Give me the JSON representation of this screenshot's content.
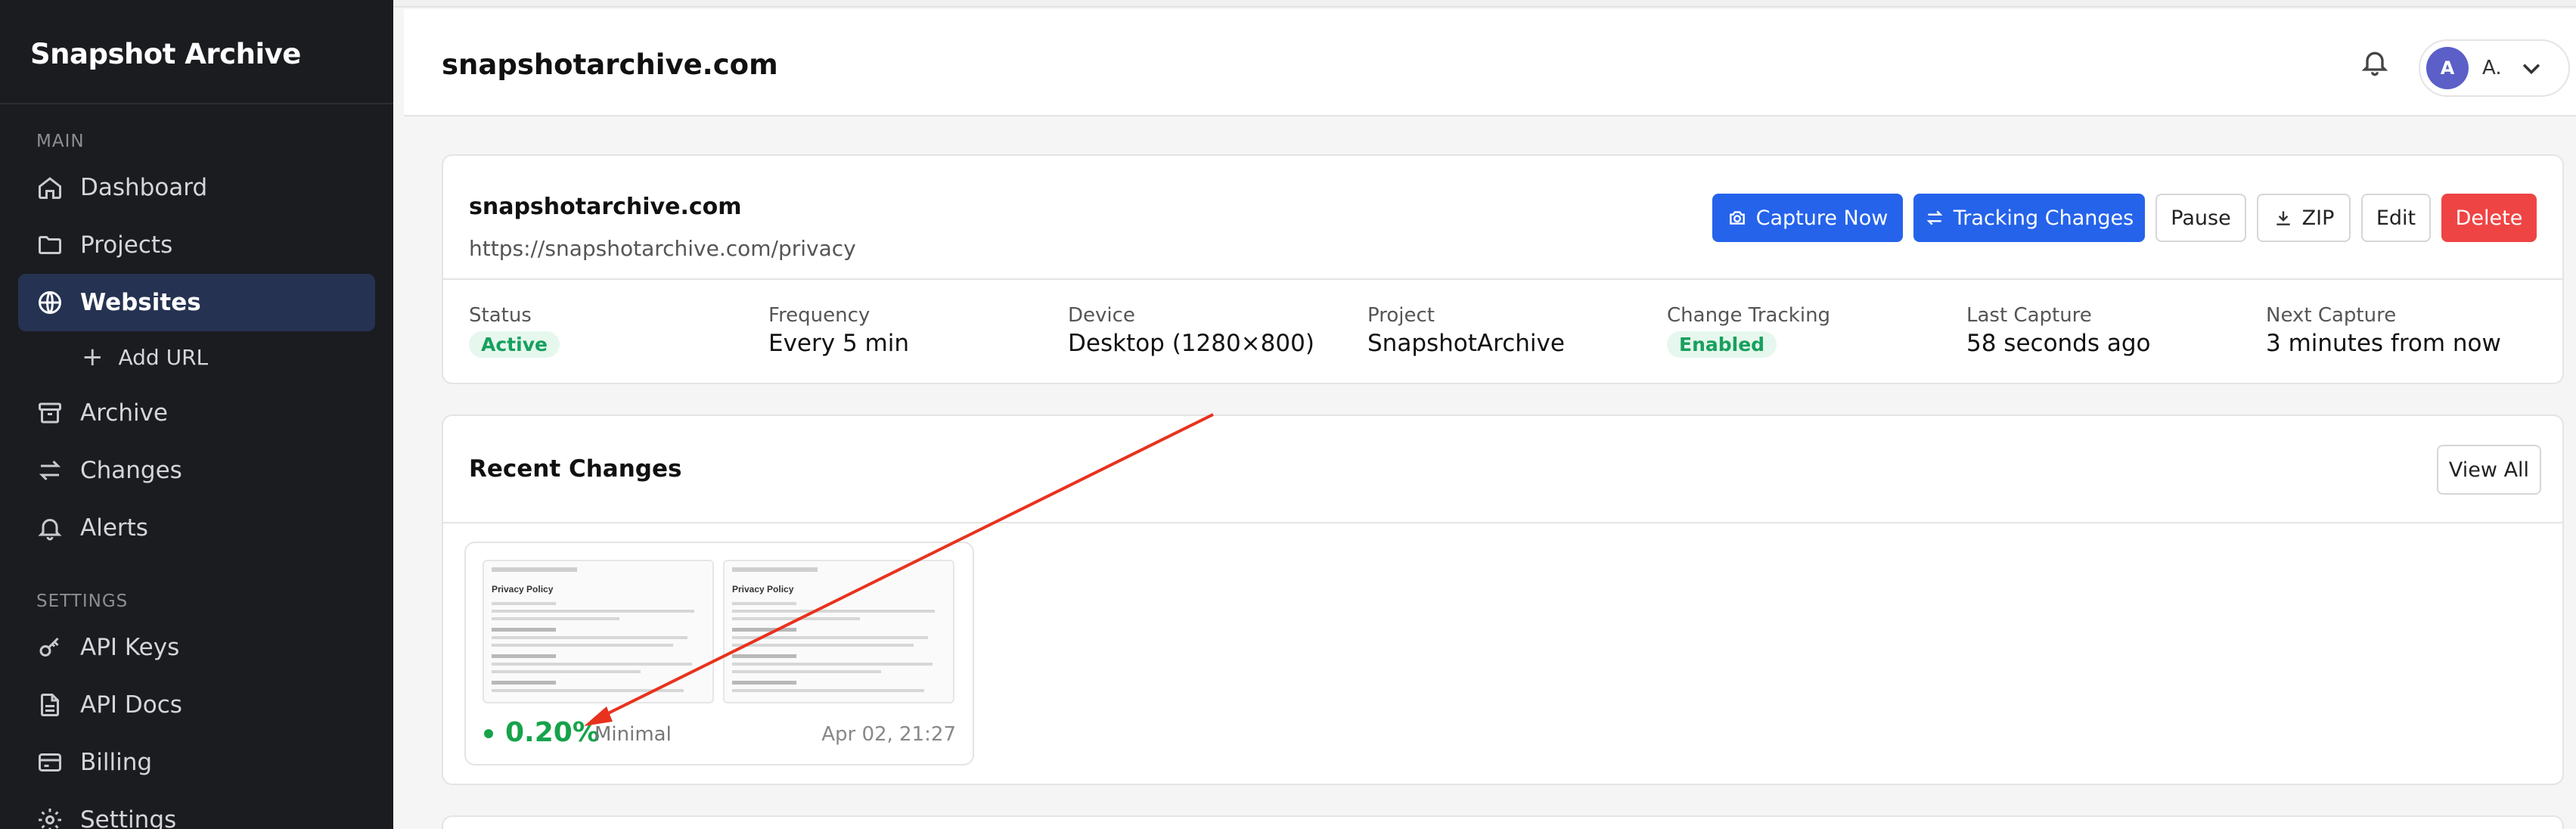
{
  "sidebar": {
    "brand": "Snapshot Archive",
    "main_label": "MAIN",
    "settings_label": "SETTINGS",
    "items": [
      {
        "label": "Dashboard",
        "icon": "home-icon"
      },
      {
        "label": "Projects",
        "icon": "folder-icon"
      },
      {
        "label": "Websites",
        "icon": "globe-icon",
        "active": true
      },
      {
        "label": "Add URL",
        "icon": "plus-icon"
      },
      {
        "label": "Archive",
        "icon": "archive-icon"
      },
      {
        "label": "Changes",
        "icon": "swap-icon"
      },
      {
        "label": "Alerts",
        "icon": "bell-icon"
      }
    ],
    "settings_items": [
      {
        "label": "API Keys",
        "icon": "key-icon"
      },
      {
        "label": "API Docs",
        "icon": "document-icon"
      },
      {
        "label": "Billing",
        "icon": "credit-card-icon"
      },
      {
        "label": "Settings",
        "icon": "gear-icon"
      }
    ]
  },
  "header": {
    "title": "snapshotarchive.com",
    "user_initial": "A",
    "user_name": "A."
  },
  "website": {
    "name": "snapshotarchive.com",
    "url": "https://snapshotarchive.com/privacy",
    "actions": {
      "capture": "Capture Now",
      "tracking": "Tracking Changes",
      "pause": "Pause",
      "zip": "ZIP",
      "edit": "Edit",
      "delete": "Delete"
    },
    "meta": {
      "status_label": "Status",
      "status_value": "Active",
      "frequency_label": "Frequency",
      "frequency_value": "Every 5 min",
      "device_label": "Device",
      "device_value": "Desktop (1280×800)",
      "project_label": "Project",
      "project_value": "SnapshotArchive",
      "tracking_label": "Change Tracking",
      "tracking_value": "Enabled",
      "last_capture_label": "Last Capture",
      "last_capture_value": "58 seconds ago",
      "next_capture_label": "Next Capture",
      "next_capture_value": "3 minutes from now"
    }
  },
  "changes": {
    "title": "Recent Changes",
    "view_all": "View All",
    "items": [
      {
        "percent": "0.20%",
        "severity": "Minimal",
        "date": "Apr 02, 21:27",
        "thumb_title": "Privacy Policy"
      }
    ]
  },
  "colors": {
    "sidebar_bg": "#1b1c20",
    "active_bg": "#253251",
    "primary": "#2563eb",
    "danger": "#ef4444",
    "success": "#16a34a",
    "annotation_arrow": "#e8321e"
  }
}
